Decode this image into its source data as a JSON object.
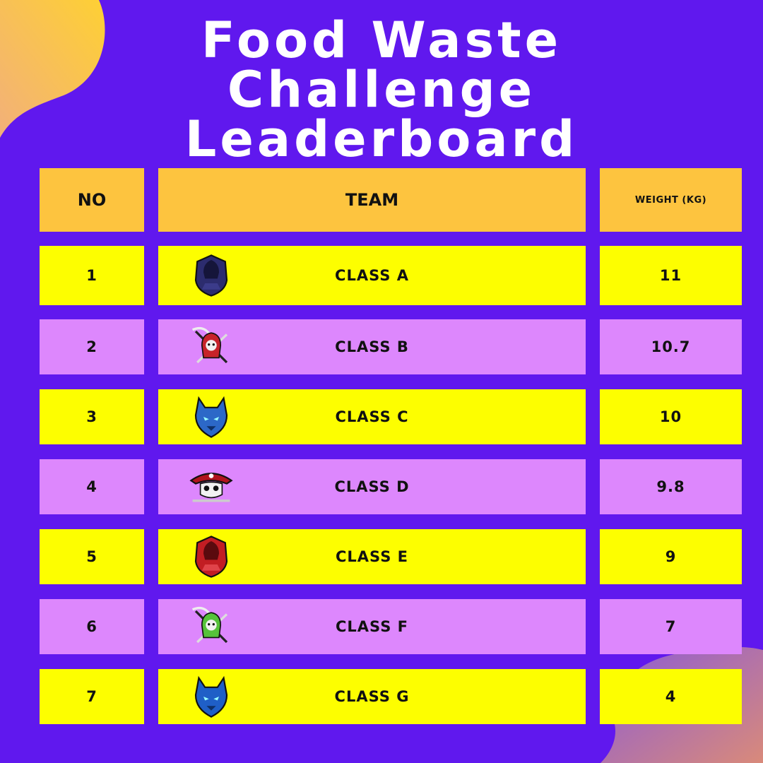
{
  "title": {
    "line1": "Food Waste",
    "line2": "Challenge",
    "line3": "Leaderboard"
  },
  "headers": {
    "no": "NO",
    "team": "TEAM",
    "weight": "WEIGHT (KG)"
  },
  "rows": [
    {
      "no": "1",
      "team": "CLASS A",
      "weight": "11",
      "logo": "hooded-figure-icon",
      "logo_color": "#2c2c6e"
    },
    {
      "no": "2",
      "team": "CLASS B",
      "weight": "10.7",
      "logo": "reaper-icon",
      "logo_color": "#c7232a"
    },
    {
      "no": "3",
      "team": "CLASS C",
      "weight": "10",
      "logo": "wolf-icon",
      "logo_color": "#2c68c8"
    },
    {
      "no": "4",
      "team": "CLASS D",
      "weight": "9.8",
      "logo": "pirate-skull-icon",
      "logo_color": "#b0141c"
    },
    {
      "no": "5",
      "team": "CLASS E",
      "weight": "9",
      "logo": "hooded-figure-icon",
      "logo_color": "#c21d23"
    },
    {
      "no": "6",
      "team": "CLASS F",
      "weight": "7",
      "logo": "reaper-icon",
      "logo_color": "#56c23a"
    },
    {
      "no": "7",
      "team": "CLASS G",
      "weight": "4",
      "logo": "wolf-icon",
      "logo_color": "#1f5fc7"
    }
  ],
  "colors": {
    "background": "#6018ee",
    "header": "#fdc43f",
    "row_yellow": "#fdfe00",
    "row_purple": "#dd87fd",
    "title": "#ffffff"
  }
}
